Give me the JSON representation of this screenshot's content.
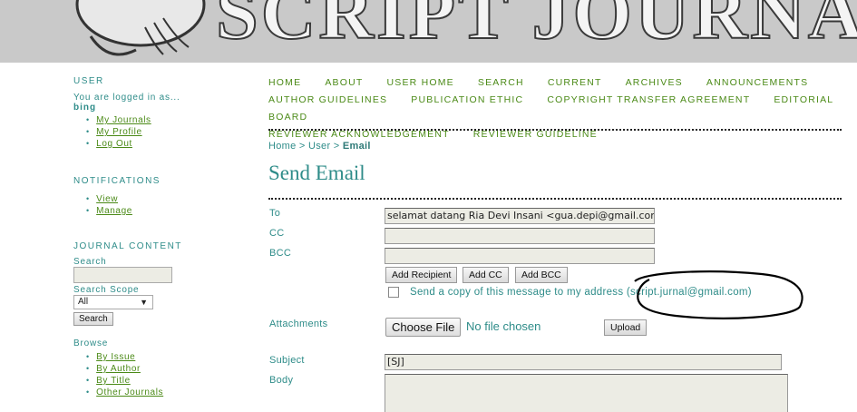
{
  "banner": {
    "title": "SCRIPT JOURNAL"
  },
  "sidebar": {
    "user": {
      "title": "User",
      "logged_in_text": "You are logged in as...",
      "username": "bing",
      "links": [
        "My Journals",
        "My Profile",
        "Log Out"
      ]
    },
    "notifications": {
      "title": "Notifications",
      "links": [
        "View",
        "Manage"
      ]
    },
    "journal_content": {
      "title": "Journal Content",
      "search_label": "Search",
      "search_value": "",
      "scope_label": "Search Scope",
      "scope_value": "All",
      "search_button": "Search",
      "browse_label": "Browse",
      "browse_links": [
        "By Issue",
        "By Author",
        "By Title",
        "Other Journals"
      ]
    }
  },
  "nav": {
    "items": [
      "Home",
      "About",
      "User Home",
      "Search",
      "Current",
      "Archives",
      "Announcements",
      "Author Guidelines",
      "Publication Ethic",
      "Copyright Transfer Agreement",
      "Editorial Board",
      "Reviewer Acknowledgement",
      "Reviewer Guideline"
    ]
  },
  "breadcrumb": {
    "home": "Home",
    "sep": ">",
    "user": "User",
    "current": "Email"
  },
  "page": {
    "title": "Send Email"
  },
  "form": {
    "to_label": "To",
    "to_value": "selamat datang Ria Devi Insani <gua.depi@gmail.com>",
    "cc_label": "CC",
    "cc_value": "",
    "bcc_label": "BCC",
    "bcc_value": "",
    "add_recipient": "Add Recipient",
    "add_cc": "Add CC",
    "add_bcc": "Add BCC",
    "send_copy_label": "Send a copy of this message to my address (script.jurnal@gmail.com)",
    "attachments_label": "Attachments",
    "choose_file": "Choose File",
    "no_file": "No file chosen",
    "upload": "Upload",
    "subject_label": "Subject",
    "subject_value": "[SJ]",
    "body_label": "Body",
    "body_value": ""
  },
  "colors": {
    "teal": "#2e8c89",
    "green_link": "#4b8a17",
    "banner_bg": "#c9c9c9",
    "field_bg": "#ecece4"
  }
}
